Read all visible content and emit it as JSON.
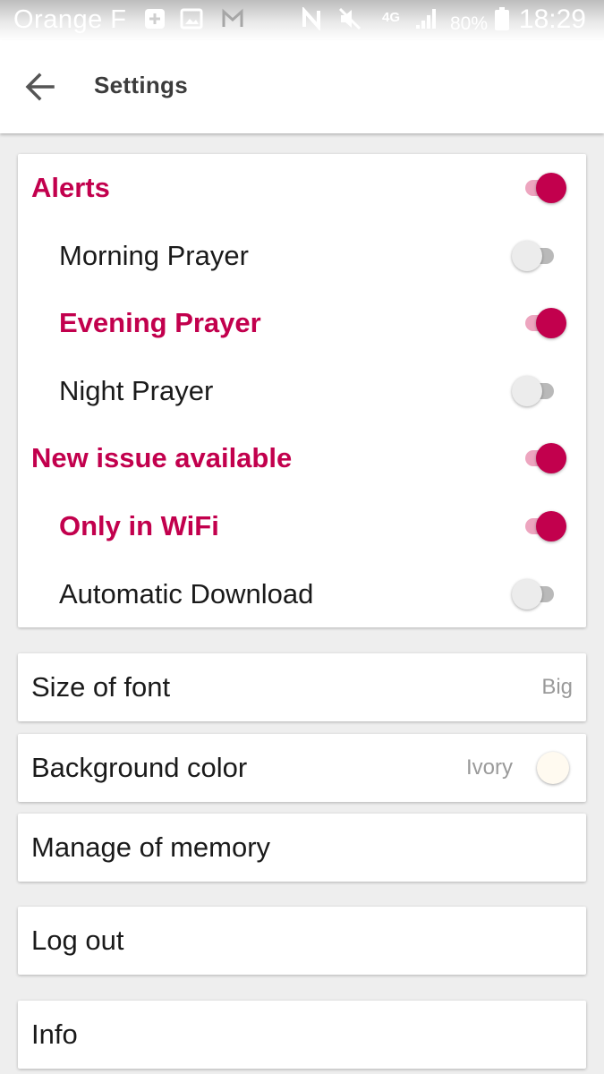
{
  "status_bar": {
    "carrier": "Orange F",
    "network_type": "4G",
    "battery_percent": "80%",
    "time": "18:29",
    "icons": [
      "add-box-icon",
      "image-icon",
      "gmail-icon",
      "nfc-icon",
      "mute-icon",
      "signal-icon",
      "battery-icon"
    ]
  },
  "app_bar": {
    "title": "Settings",
    "back_icon": "arrow-back-icon"
  },
  "alerts_card": {
    "items": [
      {
        "label": "Alerts",
        "on": true,
        "level": "top"
      },
      {
        "label": "Morning Prayer",
        "on": false,
        "level": "sub"
      },
      {
        "label": "Evening Prayer",
        "on": true,
        "level": "sub"
      },
      {
        "label": "Night Prayer",
        "on": false,
        "level": "sub"
      },
      {
        "label": "New issue available",
        "on": true,
        "level": "top"
      },
      {
        "label": "Only in WiFi",
        "on": true,
        "level": "sub"
      },
      {
        "label": "Automatic Download",
        "on": false,
        "level": "sub"
      }
    ]
  },
  "font_size": {
    "label": "Size of font",
    "value": "Big"
  },
  "background_color": {
    "label": "Background color",
    "value": "Ivory",
    "swatch_color": "#fffaf0"
  },
  "memory": {
    "label": "Manage of memory"
  },
  "logout": {
    "label": "Log out"
  },
  "info": {
    "label": "Info"
  },
  "colors": {
    "accent": "#c2004d",
    "accent_track": "#eda5bf",
    "off_track": "#b9b9b9",
    "off_thumb": "#ececec",
    "background": "#eeeeee"
  }
}
